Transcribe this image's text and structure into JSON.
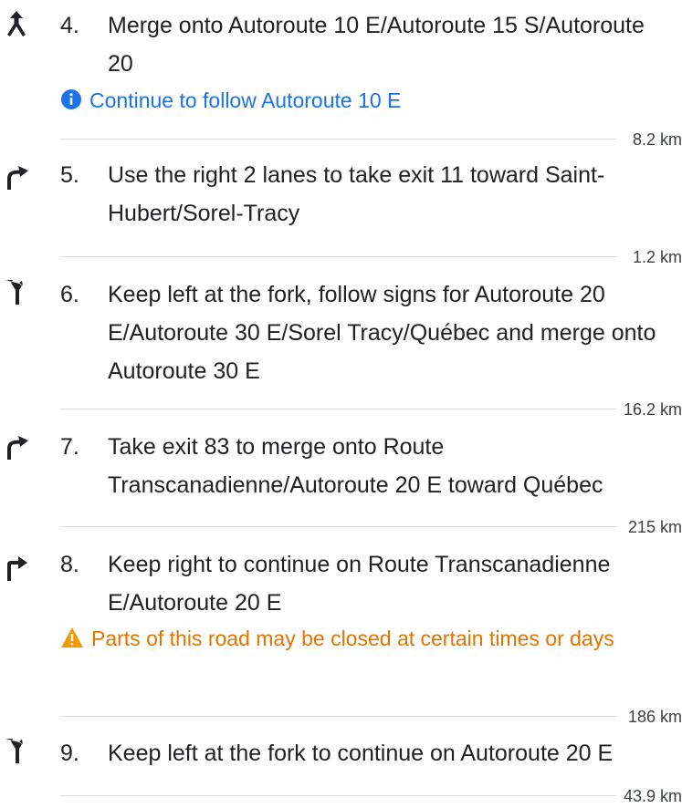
{
  "steps": [
    {
      "number": "4.",
      "maneuver_icon": "merge-icon",
      "instruction": "Merge onto Autoroute 10 E/Autoroute 15 S/Autoroute 20",
      "note": {
        "type": "info",
        "icon": "info-icon",
        "text": "Continue to follow Autoroute 10 E"
      },
      "distance": "8.2 km"
    },
    {
      "number": "5.",
      "maneuver_icon": "slight-right-icon",
      "instruction": "Use the right 2 lanes to take exit 11 toward Saint-Hubert/Sorel-Tracy",
      "distance": "1.2 km"
    },
    {
      "number": "6.",
      "maneuver_icon": "fork-left-icon",
      "instruction": "Keep left at the fork, follow signs for Autoroute 20 E/Autoroute 30 E/Sorel Tracy/Québec and merge onto Autoroute 30 E",
      "distance": "16.2 km"
    },
    {
      "number": "7.",
      "maneuver_icon": "slight-right-icon",
      "instruction": "Take exit 83 to merge onto Route Transcanadienne/Autoroute 20 E toward Québec",
      "distance": "215 km"
    },
    {
      "number": "8.",
      "maneuver_icon": "keep-right-icon",
      "instruction": "Keep right to continue on Route Transcanadienne E/Autoroute 20 E",
      "note": {
        "type": "warn",
        "icon": "warning-icon",
        "text": "Parts of this road may be closed at certain times or days"
      },
      "distance": "186 km"
    },
    {
      "number": "9.",
      "maneuver_icon": "fork-left-icon",
      "instruction": "Keep left at the fork to continue on Autoroute 20 E",
      "distance": "43.9 km"
    }
  ],
  "colors": {
    "text": "#202124",
    "info": "#1a73e8",
    "warning": "#e37400",
    "divider": "#dadce0"
  }
}
